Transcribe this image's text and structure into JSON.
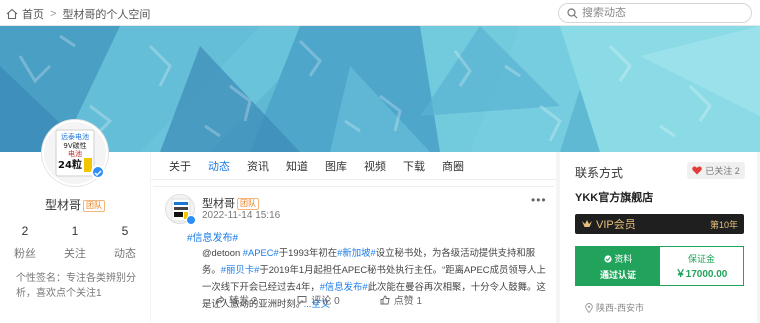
{
  "breadcrumb": {
    "home": "首页",
    "separator": ">",
    "current": "型材哥的个人空间"
  },
  "search": {
    "placeholder": "搜索动态"
  },
  "colors": {
    "accent": "#1a7ce8",
    "green": "#21a35b",
    "vip_gold": "#e6c07a",
    "verify_blue": "#2c8ef8"
  },
  "profile": {
    "avatar_text": {
      "brand": "远泰电池",
      "line1": "9V碳性",
      "line2": "电池",
      "count": "24粒"
    },
    "name": "型材哥",
    "badge": "团队",
    "stats": [
      {
        "value": "2",
        "label": "粉丝"
      },
      {
        "value": "1",
        "label": "关注"
      },
      {
        "value": "5",
        "label": "动态"
      }
    ],
    "bio": "个性签名：专注各类辨别分析，喜欢点个关注1"
  },
  "tabs": [
    "关于",
    "动态",
    "资讯",
    "知道",
    "图库",
    "视频",
    "下载",
    "商圈"
  ],
  "active_tab": 1,
  "post": {
    "author": "型材哥",
    "badge": "团队",
    "time": "2022-11-14 15:16",
    "more": "•••",
    "topic": "#信息发布#",
    "segments": [
      {
        "t": "@detoon ",
        "hl": false
      },
      {
        "t": "#APEC#",
        "hl": true
      },
      {
        "t": "于1993年初在",
        "hl": false
      },
      {
        "t": "#新加坡#",
        "hl": true
      },
      {
        "t": "设立秘书处，为各级活动提供支持和服务。",
        "hl": false
      },
      {
        "t": "#丽贝卡#",
        "hl": true
      },
      {
        "t": "于2019年1月起担任APEC秘书处执行主任。“距离APEC成员领导人上一次线下开会已经过去4年，",
        "hl": false
      },
      {
        "t": "#信息发布#",
        "hl": true
      },
      {
        "t": "此次能在曼谷再次相聚，十分令人鼓舞。这是让人激动的亚洲时刻。”",
        "hl": false
      },
      {
        "t": "...全文",
        "hl": true
      }
    ],
    "actions": [
      {
        "icon": "share-icon",
        "label": "转发 2"
      },
      {
        "icon": "comment-icon",
        "label": "评论 0"
      },
      {
        "icon": "like-icon",
        "label": "点赞 1"
      }
    ]
  },
  "contact": {
    "title": "联系方式",
    "follow_label": "已关注",
    "follow_count": "2",
    "shop": "YKK官方旗舰店",
    "vip_label": "VIP会员",
    "vip_years": "第10年",
    "cert_left_1": "资料",
    "cert_left_2": "通过认证",
    "cert_right_1": "保证金",
    "cert_right_2": "￥17000.00",
    "location": "陕西-西安市"
  }
}
